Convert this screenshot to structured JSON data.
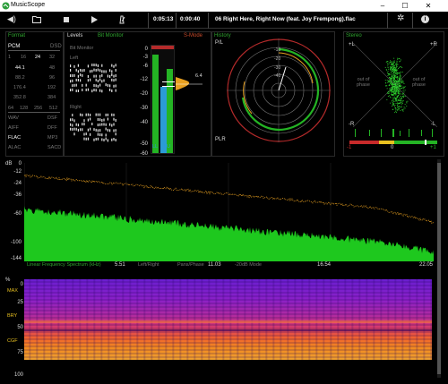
{
  "window": {
    "title": "MusicScope"
  },
  "toolbar": {
    "time_elapsed": "0:05:13",
    "time_remaining": "0:00:40",
    "track_title": "06 Right Here, Right Now (feat. Joy Frempong).flac"
  },
  "format": {
    "title": "Format",
    "pcm_label": "PCM",
    "dsd_label": "DSD",
    "bit_depths": [
      "1",
      "16",
      "24",
      "32"
    ],
    "sample_rates": [
      [
        "44.1",
        "48"
      ],
      [
        "88.2",
        "96"
      ],
      [
        "176.4",
        "192"
      ],
      [
        "352.8",
        "384"
      ]
    ],
    "dsd_rates": [
      "64",
      "128",
      "256",
      "512"
    ],
    "containers": [
      [
        "WAV",
        "DSF"
      ],
      [
        "AIFF",
        "DFF"
      ],
      [
        "FLAC",
        "MP3"
      ],
      [
        "ALAC",
        "SACD"
      ]
    ]
  },
  "levels": {
    "title": "Levels",
    "mode": "Bit Monitor",
    "bit_monitor_label": "Bit Monitor",
    "left_label": "Left",
    "right_label": "Right",
    "s_mode": "S-Mode",
    "scale": [
      "0",
      "-3",
      "-6",
      "-12",
      "-20",
      "-30",
      "-40",
      "-50",
      "-60"
    ],
    "channel_labels": [
      "LL",
      "LU"
    ],
    "peak_value": "6.4",
    "level_l_fraction": 0.92,
    "level_r_fraction": 0.78
  },
  "history": {
    "title": "History",
    "pl_label": "P/L",
    "plr_label": "PLR"
  },
  "stereo": {
    "title": "Stereo",
    "plus_l": "+L",
    "plus_r": "+R",
    "minus_l": "-L",
    "minus_r": "-R",
    "out_of_phase_left": "out of\nphase",
    "out_of_phase_right": "out of\nphase",
    "corr_min": "-1",
    "corr_mid": "0",
    "corr_max": "+1"
  },
  "spectrum": {
    "db_label": "dB",
    "y_ticks": [
      "0",
      "-12",
      "-24",
      "-36",
      "-60",
      "-100",
      "-144"
    ],
    "mode_label": "Linear Frequency Spectrum (kHz)",
    "x_ticks": [
      "5.51",
      "11.03",
      "16.54",
      "22.05"
    ],
    "options": [
      "Left/Right",
      "Pans/Phase",
      "-20dB Mode"
    ]
  },
  "spectrogram": {
    "y_ticks": [
      "%",
      "0",
      "25",
      "50",
      "75",
      "100"
    ],
    "markers": [
      "MAX",
      "BRY",
      "CGF"
    ]
  },
  "colors": {
    "accent": "#2fa52f",
    "spectrum_fill": "#1ec81e",
    "peak_line": "#e8a020",
    "bar_blue": "#2b9bd6",
    "bar_green": "#24b424"
  }
}
